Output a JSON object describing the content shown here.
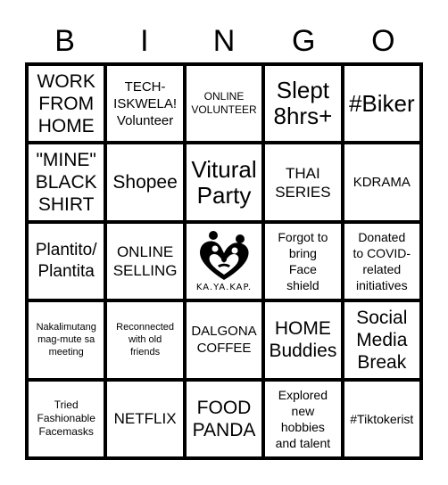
{
  "header": {
    "letters": [
      "B",
      "I",
      "N",
      "G",
      "O"
    ]
  },
  "board": {
    "cells": [
      {
        "text": "WORK\nFROM\nHOME",
        "size": "s-l"
      },
      {
        "text": "TECH-\nISKWELA!\nVolunteer",
        "size": "s-ms"
      },
      {
        "text": "ONLINE\nVOLUNTEER",
        "size": "s-xs"
      },
      {
        "text": "Slept\n8hrs+",
        "size": "s-xl"
      },
      {
        "text": "#Biker",
        "size": "s-xl"
      },
      {
        "text": "\"MINE\"\nBLACK\nSHIRT",
        "size": "s-l"
      },
      {
        "text": "Shopee",
        "size": "s-l"
      },
      {
        "text": "Vitural\nParty",
        "size": "s-xl"
      },
      {
        "text": "THAI\nSERIES",
        "size": "s-m"
      },
      {
        "text": "KDRAMA",
        "size": "s-ms"
      },
      {
        "text": "Plantito/\nPlantita",
        "size": "s-ml"
      },
      {
        "text": "ONLINE\nSELLING",
        "size": "s-m"
      },
      {
        "text": "",
        "size": "logo",
        "logo_text": "KA.YA.KAP.",
        "icon": "family-heart-logo"
      },
      {
        "text": "Forgot to\nbring\nFace\nshield",
        "size": "s-s"
      },
      {
        "text": "Donated\nto COVID-\nrelated\ninitiatives",
        "size": "s-s"
      },
      {
        "text": "Nakalimutang\nmag-mute sa\nmeeting",
        "size": "s-xxs"
      },
      {
        "text": "Reconnected\nwith old\nfriends",
        "size": "s-xxs"
      },
      {
        "text": "DALGONA\nCOFFEE",
        "size": "s-ms"
      },
      {
        "text": "HOME\nBuddies",
        "size": "s-l"
      },
      {
        "text": "Social\nMedia\nBreak",
        "size": "s-l"
      },
      {
        "text": "Tried\nFashionable\nFacemasks",
        "size": "s-xs"
      },
      {
        "text": "NETFLIX",
        "size": "s-m"
      },
      {
        "text": "FOOD\nPANDA",
        "size": "s-l"
      },
      {
        "text": "Explored\nnew\nhobbies\nand talent",
        "size": "s-s"
      },
      {
        "text": "#Tiktokerist",
        "size": "s-s"
      }
    ]
  }
}
